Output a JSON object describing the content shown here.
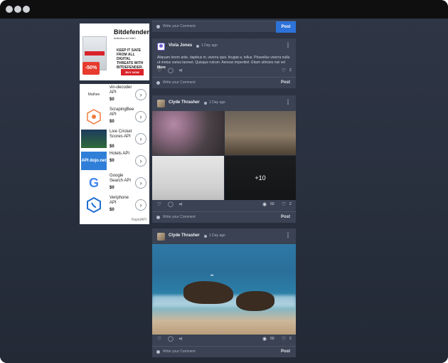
{
  "ads": {
    "bitdefender": {
      "brand": "Bitdefender",
      "subtitle": "Antivirus for MAC",
      "text": "Keep it safe from all digital threats with Bitdefender.",
      "buy": "BUY NOW",
      "badge": "-50%",
      "box_text": "BITDEFENDER ANTIVIRUS FOR MAC"
    },
    "rapidapi": {
      "items": [
        {
          "name": "vin-decoder API",
          "price": "$0",
          "logo": "Mathee"
        },
        {
          "name": "ScrapingBee API",
          "price": "$0",
          "logo": ""
        },
        {
          "name": "Live Cricket Scores API",
          "price": "$0",
          "logo": ""
        },
        {
          "name": "Hotels API",
          "price": "$0",
          "logo": "API dojo.net"
        },
        {
          "name": "Google Search API",
          "price": "$0",
          "logo": "G"
        },
        {
          "name": "Veriphone API",
          "price": "$0",
          "logo": ""
        }
      ],
      "footer": "RapidAPI"
    }
  },
  "feed": {
    "comment_placeholder": "Write your Comment",
    "post_label": "Post",
    "posts": [
      {
        "user": "Viola Jones",
        "ago": "1 Day ago",
        "text": "Aliquam lorem ante, dapibus in, viverra quis, feugiat a, tellus. Phasellus viverra nulla ut metus varius laoreet. Quisque rutrum. Aenean imperdiet. Etiam ultricies nisi vel",
        "more": "More",
        "likes": "2"
      },
      {
        "user": "Clyde Thrasher",
        "ago": "1 Day ago",
        "views": "50",
        "likes": "2",
        "more_images": "+10"
      },
      {
        "user": "Clyde Thrasher",
        "ago": "1 Day ago",
        "views": "50",
        "likes": "2"
      }
    ]
  },
  "colors": {
    "background": "#262d3a",
    "card": "#3a4253",
    "post_button": "#2d72d9",
    "titlebar": "#0f0f10"
  },
  "icons": [
    "heart-icon",
    "comment-icon",
    "share-icon",
    "eye-icon",
    "kebab-icon",
    "chevron-right-icon"
  ]
}
